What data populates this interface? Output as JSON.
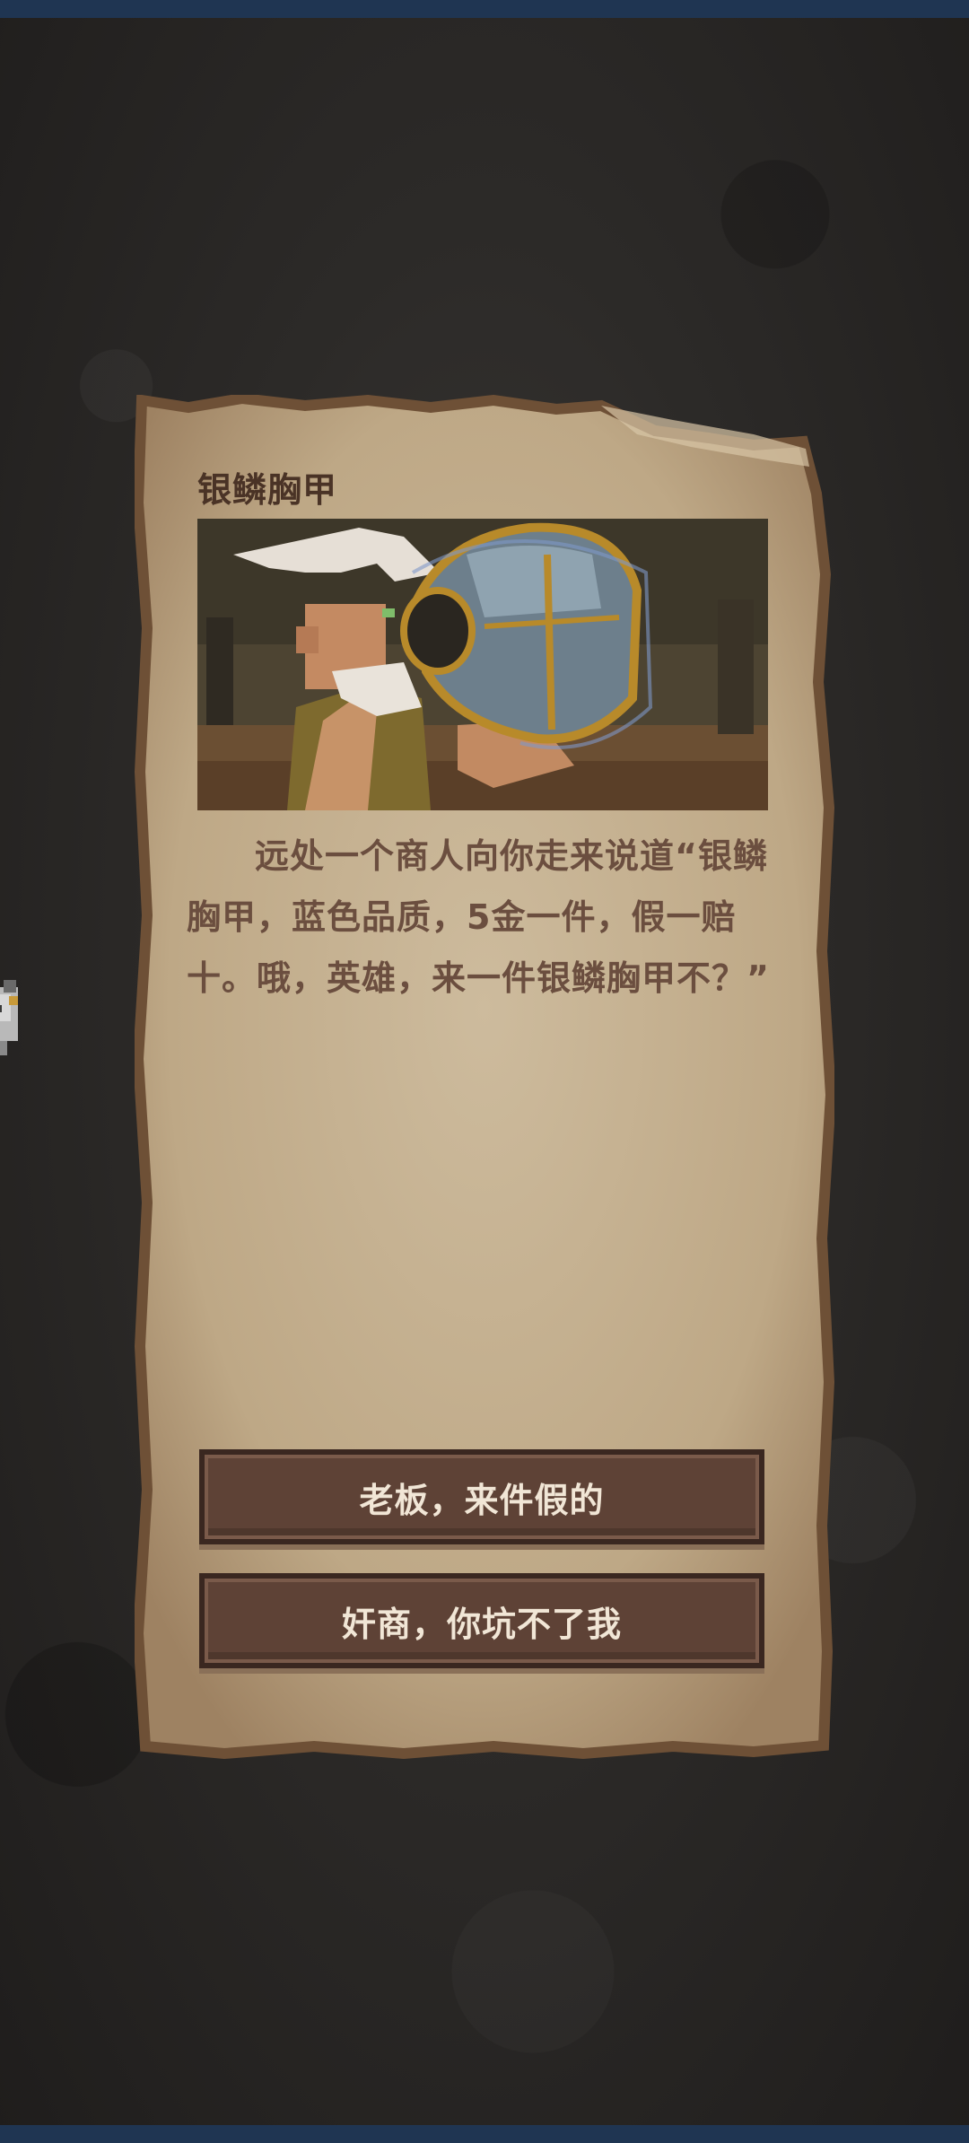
{
  "event": {
    "title": "银鳞胸甲",
    "illustration_icon": "merchant-with-chestplate",
    "story": "远处一个商人向你走来说道“银鳞胸甲，蓝色品质，5金一件，假一赔十。哦，英雄，来一件银鳞胸甲不？”"
  },
  "choices": [
    {
      "label": "老板，来件假的"
    },
    {
      "label": "奸商，你坑不了我"
    }
  ],
  "colors": {
    "parchment": "#c8b496",
    "parchment_edge": "#8a6a4a",
    "title_text": "#4a3326",
    "story_text": "#6b4e3f",
    "button_bg": "#5e4236",
    "button_text": "#f1e6d6",
    "status_bar": "#1f3552"
  }
}
